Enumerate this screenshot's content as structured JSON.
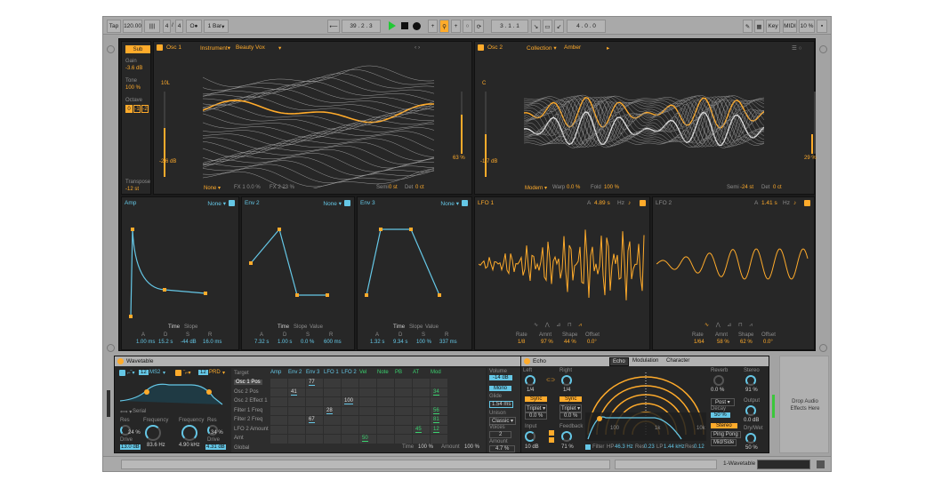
{
  "transport": {
    "tap": "Tap",
    "tempo": "120.00",
    "sig_num": "4",
    "sig_den": "4",
    "quant": "1 Bar",
    "position": "39 . 2 . 3",
    "loop_start": "3 . 1 . 1",
    "loop_len": "4 . 0 . 0",
    "key": "Key",
    "midi": "MIDI",
    "cpu": "10 %"
  },
  "osc1": {
    "title": "Osc 1",
    "category": "Instrument",
    "wavetable": "Beauty Vox",
    "level": "10L",
    "gain": "-2.6 dB",
    "effect": "None",
    "fx1": "FX 1 0.0 %",
    "fx2": "FX 2 23 %",
    "semi": "Semi",
    "semi_val": "0 st",
    "det": "Det",
    "det_val": "0 ct",
    "pos": "63 %"
  },
  "osc2": {
    "title": "Osc 2",
    "category": "Collection",
    "wavetable": "Amber",
    "level": "C",
    "gain": "-1.7 dB",
    "effect": "Modern",
    "warp": "Warp",
    "warp_val": "0.0 %",
    "fold": "Fold",
    "fold_val": "100 %",
    "semi": "Semi",
    "semi_val": "-24 st",
    "det": "Det",
    "det_val": "0 ct",
    "pos": "29 %"
  },
  "sub": {
    "label": "Sub",
    "gain": "Gain",
    "gain_val": "-3.6 dB",
    "tone": "Tone",
    "tone_val": "100 %",
    "octave": "Octave",
    "oct_opts": [
      "0",
      "-1",
      "-2"
    ],
    "transpose": "Transpose",
    "transpose_val": "-12 st"
  },
  "amp": {
    "title": "Amp",
    "mode": "None",
    "tab_time": "Time",
    "tab_slope": "Slope",
    "labels": [
      "A",
      "D",
      "S",
      "R"
    ],
    "values": [
      "1.00 ms",
      "15.2 s",
      "-44 dB",
      "16.0 ms"
    ]
  },
  "env2": {
    "title": "Env 2",
    "mode": "None",
    "tab_time": "Time",
    "tab_slope": "Slope",
    "tab_value": "Value",
    "labels": [
      "A",
      "D",
      "S",
      "R"
    ],
    "values": [
      "7.32 s",
      "1.00 s",
      "0.0 %",
      "600 ms"
    ]
  },
  "env3": {
    "title": "Env 3",
    "mode": "None",
    "tab_time": "Time",
    "tab_slope": "Slope",
    "tab_value": "Value",
    "labels": [
      "A",
      "D",
      "S",
      "R"
    ],
    "values": [
      "1.32 s",
      "9.34 s",
      "100 %",
      "337 ms"
    ]
  },
  "lfo1": {
    "title": "LFO 1",
    "a": "A",
    "a_val": "4.89 s",
    "hz": "Hz",
    "labels": [
      "Rate",
      "Amnt",
      "Shape",
      "Offset"
    ],
    "values": [
      "1/8",
      "97 %",
      "44 %",
      "0.0°"
    ]
  },
  "lfo2": {
    "title": "LFO 2",
    "a": "A",
    "a_val": "1.41 s",
    "hz": "Hz",
    "labels": [
      "Rate",
      "Amnt",
      "Shape",
      "Offset"
    ],
    "values": [
      "1/64",
      "58 %",
      "62 %",
      "0.0°"
    ]
  },
  "device": {
    "title": "Wavetable",
    "f1_num": "12",
    "f1_type": "MS2",
    "f2_num": "12",
    "f2_type": "PRD",
    "routing": "Serial",
    "res": "Res",
    "res_val": "24 %",
    "freq": "Frequency",
    "freq_val": "83.6 Hz",
    "drive": "Drive",
    "drive1_val": "13.0 dB",
    "freq2": "Frequency",
    "freq2_val": "4.90 kHz",
    "res2": "Res",
    "res2_val": "34 %",
    "drive2": "Drive",
    "drive2_val": "4.31 dB"
  },
  "matrix": {
    "target": "Target",
    "cols": [
      "Amp",
      "Env 2",
      "Env 3",
      "LFO 1",
      "LFO 2",
      "Vel",
      "Note",
      "PB",
      "AT",
      "Mod"
    ],
    "rows": [
      "Osc 1 Pos",
      "Osc 2 Pos",
      "Osc 2 Effect 1",
      "Filter 1 Freq",
      "Filter 2 Freq",
      "LFO 2 Amount",
      "Amt",
      "Global"
    ],
    "values": [
      {
        "r": 0,
        "c": 2,
        "v": "77"
      },
      {
        "r": 1,
        "c": 1,
        "v": "41"
      },
      {
        "r": 1,
        "c": 9,
        "v": "34"
      },
      {
        "r": 2,
        "c": 4,
        "v": "100"
      },
      {
        "r": 3,
        "c": 3,
        "v": "28"
      },
      {
        "r": 3,
        "c": 9,
        "v": "56"
      },
      {
        "r": 4,
        "c": 2,
        "v": "67"
      },
      {
        "r": 4,
        "c": 9,
        "v": "81"
      },
      {
        "r": 5,
        "c": 8,
        "v": "45"
      },
      {
        "r": 5,
        "c": 9,
        "v": "12"
      },
      {
        "r": 6,
        "c": 5,
        "v": "50"
      }
    ],
    "time": "Time",
    "time_val": "100 %",
    "amount": "Amount",
    "amount_val": "100 %"
  },
  "voice": {
    "volume": "Volume",
    "volume_val": "-14 dB",
    "mono": "Mono",
    "glide": "Glide",
    "glide_val": "1.54 ms",
    "unison": "Unison",
    "unison_val": "Classic",
    "voices": "Voices",
    "voices_val": "2",
    "amount": "Amount",
    "amount_val": "4.7 %"
  },
  "echo": {
    "title": "Echo",
    "tabs": [
      "Echo",
      "Modulation",
      "Character"
    ],
    "left": "Left",
    "right": "Right",
    "left_val": "1/4",
    "right_val": "1/4",
    "sync": "Sync",
    "triplet": "Triplet",
    "left_off": "0.0 %",
    "right_off": "0.0 %",
    "input": "Input",
    "input_val": "10 dB",
    "feedback": "Feedback",
    "feedback_val": "71 %",
    "filter": "Filter",
    "hp": "HP",
    "hp_val": "46.3 Hz",
    "res": "Res",
    "res1_val": "0.23",
    "lp": "LP",
    "lp_val": "1.44 kHz",
    "res2_val": "0.12",
    "freqs": [
      "100",
      "1k",
      "10k"
    ],
    "reverb": "Reverb",
    "reverb_val": "0.0 %",
    "stereo": "Stereo",
    "stereo_val": "91 %",
    "pos": "Post",
    "decay": "Decay",
    "decay_val": "50 %",
    "output": "Output",
    "output_val": "0.0 dB",
    "mode1": "Stereo",
    "mode2": "Ping Pong",
    "mode3": "Mid/Side",
    "drywet": "Dry/Wet",
    "drywet_val": "50 %"
  },
  "drop": {
    "line1": "Drop Audio",
    "line2": "Effects Here"
  },
  "track": {
    "name": "1-Wavetable"
  }
}
